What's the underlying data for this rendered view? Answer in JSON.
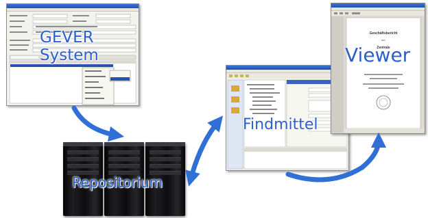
{
  "labels": {
    "gever_line1": "GEVER",
    "gever_line2": "System",
    "repository": "Repositorium",
    "finding_aid": "Findmittel",
    "viewer": "Viewer"
  },
  "viewer_document": {
    "heading": "Geschäftsbericht",
    "line2": "der",
    "line3": "Zentrale"
  },
  "colors": {
    "label_text": "#2a5fd0",
    "arrow": "#2f6fd6",
    "server_body": "#111114"
  }
}
